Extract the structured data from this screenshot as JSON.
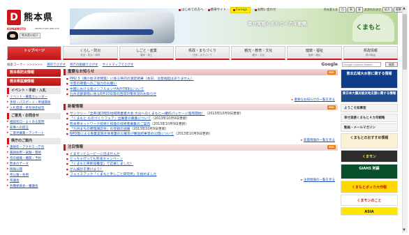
{
  "header": {
    "logo_mark": "D",
    "logo_text": "熊本県",
    "logo_sub_en": "KUMAMOTO",
    "logo_sub_small": "PREFECTURE WEB SITE",
    "sitemap_mini": "熊本県の紹介",
    "slogan": "幸せ実感くまもと４カ年戦略",
    "kumamon_text": "くまもと"
  },
  "toplinks": [
    {
      "label": "はじめての方へ"
    },
    {
      "label": "携帯サイト"
    },
    {
      "label": "Foreign"
    },
    {
      "label": "お問い合わせ"
    }
  ],
  "font_ctrl": {
    "label": "色を変える",
    "options": [
      "白",
      "黒",
      "青"
    ],
    "size_label": "文字の大きさ",
    "bigger": "拡大",
    "normal": "標準"
  },
  "nav": {
    "tabs": [
      {
        "label": "トップページ",
        "sub": ""
      },
      {
        "label": "くらし・防災",
        "sub": "安全・防災・環境"
      },
      {
        "label": "しごと・産業",
        "sub": "農林・商工"
      },
      {
        "label": "県政・まちづくり",
        "sub": "行政・まちづくり"
      },
      {
        "label": "観光・教育・文化",
        "sub": "観光・文化"
      },
      {
        "label": "健康・福祉",
        "sub": "医療・福祉"
      },
      {
        "label": "県政情報",
        "sub": "県の取組"
      }
    ],
    "right_label": "Select Language"
  },
  "crumbrow": {
    "label": "検索コーナー >>>>>>",
    "links": [
      "目的でさがす",
      "県庁の組織でさがす",
      "サイトマップでさがす"
    ],
    "google": "Google",
    "search_placeholder": "Google Custom Search",
    "search_button": "検索"
  },
  "left": {
    "buttons": [
      "熊本県防災情報",
      "熊本県医療情報"
    ],
    "sections": [
      {
        "head": "イベント・手続・入札",
        "items": [
          "イベント・募集カレンダー",
          "手続・パスポート・申請関係",
          "入札関連・県有地売却等"
        ]
      },
      {
        "head": "ご意見・お問合せ",
        "items": [
          "相談窓口・よくある質問",
          "知事への提言",
          "ご意見募集・アンケート"
        ]
      },
      {
        "head": "県庁のご案内",
        "items": [
          "連絡先・アクセス・庁舎",
          "職員採用・試験・資格",
          "県の組織・機関・予約",
          "熊本のデータ",
          "情報公開",
          "県公報・条例",
          "県議会",
          "各種委員会・審議会"
        ]
      }
    ]
  },
  "main": {
    "sections": [
      {
        "head": "重要なお知らせ",
        "urgent": true,
        "rss": "RSS",
        "items": [
          {
            "title": "PM2.5（微小粒子状物質）に係る県内の測定結果（本日、注意喚起はありません）",
            "date": ""
          },
          {
            "title": "今夏の節電へのご協力のお願い",
            "date": ""
          },
          {
            "title": "中国における鳥インフルエンザA(H7N9)について",
            "date": ""
          },
          {
            "title": "九州北部豪雨に係る8月10日等の回収対策状況のお知らせ",
            "date": ""
          }
        ],
        "more": "重要なお知らせの一覧を見る"
      },
      {
        "head": "新着情報",
        "urgent": false,
        "rss": "RSS",
        "items": [
          {
            "title": "サンクリー「全県(第38回)地域商業者大会 大分へのくまもと一緒作パッケージ発売開始！",
            "date": "（2013年10月9日更新）"
          },
          {
            "title": "「くまもと ものづくりフェア」出展者の募集について",
            "date": "（2013年10月9日更新）"
          },
          {
            "title": "熊本県ネットワーク技術と技能の技術者募集のご案内",
            "date": "（2013年10月9日更新）"
          },
          {
            "title": "「九州まちの雑理讃説会」の登録の詳細",
            "date": "（2013年10月9日更新）"
          },
          {
            "title": "NPO等による事業実施主体事業の公募及び審査結果等の公開について",
            "date": "（2013年10月9日更新）"
          }
        ],
        "more": "新着情報の一覧を見る"
      },
      {
        "head": "注目情報",
        "urgent": false,
        "rss": "RSS",
        "items": [
          {
            "title": "くまモンとムービーに出ませんか",
            "date": ""
          },
          {
            "title": "どっちゃ行っても熊本キャンペーン",
            "date": ""
          },
          {
            "title": "「くまもと県民協働型」で応援しました！",
            "date": ""
          },
          {
            "title": "がん検診を受けよう！",
            "date": ""
          },
          {
            "title": "フェイスブック「くまもと手しごと研究所」を始めました",
            "date": ""
          }
        ],
        "more": "注目情報の一覧を見る"
      }
    ]
  },
  "right": {
    "banners": [
      {
        "text": "熊本広域大水害に関する情報",
        "kind": "flood"
      },
      {
        "text": "東日本大震災被災地支援に関する情報",
        "kind": "business"
      },
      {
        "text": "ようこそ知事室",
        "kind": "small"
      },
      {
        "text": "幸せ実感くまもと４カ年戦略",
        "kind": "small"
      },
      {
        "text": "動画・メールマガジン",
        "kind": "small"
      },
      {
        "text": "くまもとのおすすめ情報",
        "kind": "kumamon"
      },
      {
        "text": "くまモン",
        "kind": "dark"
      },
      {
        "text": "GIAHS 阿蘇",
        "kind": "giahs"
      },
      {
        "text": "くまもとボッカ大作戦",
        "kind": "yellow"
      },
      {
        "text": "くまモンのこと",
        "kind": "red"
      },
      {
        "text": "ASIA",
        "kind": "asia"
      }
    ]
  },
  "colors": {
    "accent": "#c8161d",
    "link": "#1a4fb4",
    "foreign_highlight": "#fff200"
  }
}
